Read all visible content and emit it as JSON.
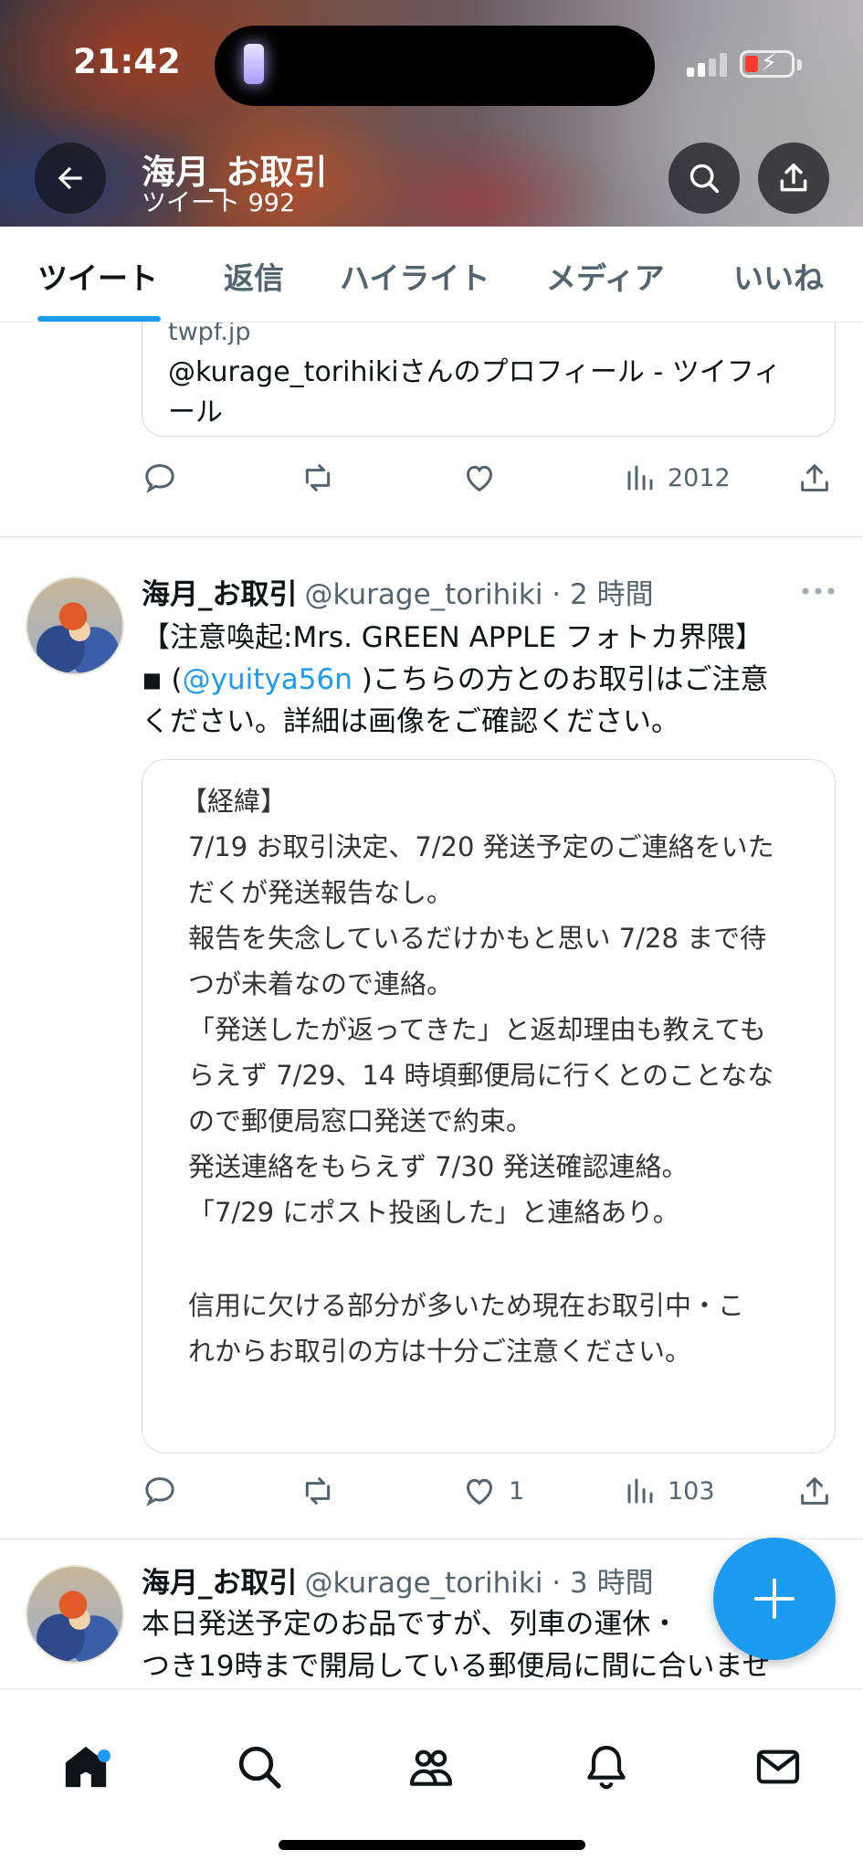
{
  "status_bar": {
    "time": "21:42"
  },
  "header": {
    "profile_name": "海月_お取引",
    "tweet_count": "ツイート 992"
  },
  "tabs": [
    {
      "label": "ツイート",
      "active": true
    },
    {
      "label": "返信",
      "active": false
    },
    {
      "label": "ハイライト",
      "active": false
    },
    {
      "label": "メディア",
      "active": false
    },
    {
      "label": "いいね",
      "active": false
    }
  ],
  "prev_tweet": {
    "link_domain": "twpf.jp",
    "link_title": "@kurage_torihikiさんのプロフィール - ツイフィール",
    "views": "2012"
  },
  "tweet1": {
    "name": "海月_お取引",
    "handle_time": "@kurage_torihiki · 2 時間",
    "text_line1": "【注意喚起:Mrs. GREEN APPLE フォトカ界隈】",
    "text_line2_prefix": "◾ (",
    "text_mention": "@yuitya56n",
    "text_line2_suffix": " )こちらの方とのお取引はご注意",
    "text_line3": "ください。詳細は画像をご確認ください。",
    "image_lines": [
      "【経緯】",
      "7/19 お取引決定、7/20 発送予定のご連絡をいた",
      "だくが発送報告なし。",
      "報告を失念しているだけかもと思い 7/28 まで待",
      "つが未着なので連絡。",
      "「発送したが返ってきた」と返却理由も教えても",
      "らえず 7/29、14 時頃郵便局に行くとのことなな",
      "ので郵便局窓口発送で約束。",
      "発送連絡をもらえず 7/30 発送確認連絡。",
      "「7/29 にポスト投函した」と連絡あり。",
      "",
      "信用に欠ける部分が多いため現在お取引中・こ",
      "れからお取引の方は十分ご注意ください。"
    ],
    "likes": "1",
    "views": "103"
  },
  "tweet2": {
    "name": "海月_お取引",
    "handle_time": "@kurage_torihiki · 3 時間",
    "text_line1": "本日発送予定のお品ですが、列車の運休・",
    "text_line2": "つき19時まで開局している郵便局に間に合いませ"
  },
  "colors": {
    "accent": "#1d9bf0",
    "secondary_text": "#536471"
  }
}
